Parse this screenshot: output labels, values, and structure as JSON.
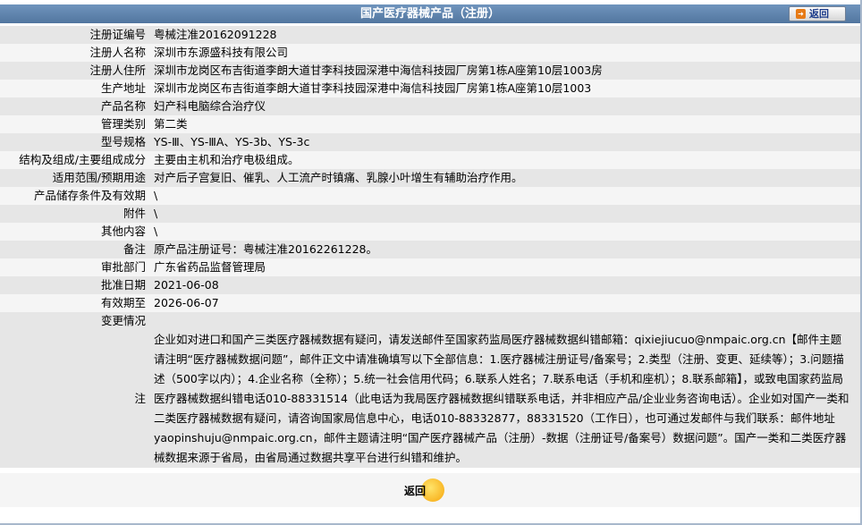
{
  "header": {
    "title": "国产医疗器械产品（注册）",
    "back_label": "返回"
  },
  "rows": [
    {
      "label": "注册证编号",
      "value": "粤械注准20162091228"
    },
    {
      "label": "注册人名称",
      "value": "深圳市东源盛科技有限公司"
    },
    {
      "label": "注册人住所",
      "value": "深圳市龙岗区布吉街道李朗大道甘李科技园深港中海信科技园厂房第1栋A座第10层1003房"
    },
    {
      "label": "生产地址",
      "value": "深圳市龙岗区布吉街道李朗大道甘李科技园深港中海信科技园厂房第1栋A座第10层1003"
    },
    {
      "label": "产品名称",
      "value": "妇产科电脑综合治疗仪"
    },
    {
      "label": "管理类别",
      "value": "第二类"
    },
    {
      "label": "型号规格",
      "value": "YS-Ⅲ、YS-ⅢA、YS-3b、YS-3c"
    },
    {
      "label": "结构及组成/主要组成成分",
      "value": "主要由主机和治疗电极组成。"
    },
    {
      "label": "适用范围/预期用途",
      "value": "对产后子宫复旧、催乳、人工流产时镇痛、乳腺小叶增生有辅助治疗作用。"
    },
    {
      "label": "产品储存条件及有效期",
      "value": "\\"
    },
    {
      "label": "附件",
      "value": "\\"
    },
    {
      "label": "其他内容",
      "value": "\\"
    },
    {
      "label": "备注",
      "value": "原产品注册证号：粤械注准20162261228。"
    },
    {
      "label": "审批部门",
      "value": "广东省药品监督管理局"
    },
    {
      "label": "批准日期",
      "value": "2021-06-08"
    },
    {
      "label": "有效期至",
      "value": "2026-06-07"
    },
    {
      "label": "变更情况",
      "value": ""
    }
  ],
  "note": {
    "label": "注",
    "text": "企业如对进口和国产三类医疗器械数据有疑问，请发送邮件至国家药监局医疗器械数据纠错邮箱：qixiejiucuo@nmpaic.org.cn【邮件主题请注明“医疗器械数据问题”，邮件正文中请准确填写以下全部信息：1.医疗器械注册证号/备案号；2.类型（注册、变更、延续等）；3.问题描述（500字以内）；4.企业名称（全称）；5.统一社会信用代码；6.联系人姓名；7.联系电话（手机和座机）；8.联系邮箱】，或致电国家药监局医疗器械数据纠错电话010-88331514（此电话为我局医疗器械数据纠错联系电话，并非相应产品/企业业务咨询电话）。企业如对国产一类和二类医疗器械数据有疑问，请咨询国家局信息中心，电话010-88332877，88331520（工作日），也可通过发邮件与我们联系：邮件地址yaopinshuju@nmpaic.org.cn，邮件主题请注明“国产医疗器械产品（注册）-数据（注册证号/备案号）数据问题”。国产一类和二类医疗器械数据来源于省局，由省局通过数据共享平台进行纠错和维护。"
  },
  "footer": {
    "back_label": "返回"
  },
  "colors": {
    "header_bg": "#5f85b0",
    "row_odd": "#e6e6e6",
    "row_even": "#f5f5f5",
    "button_accent": "#f6a50b"
  }
}
